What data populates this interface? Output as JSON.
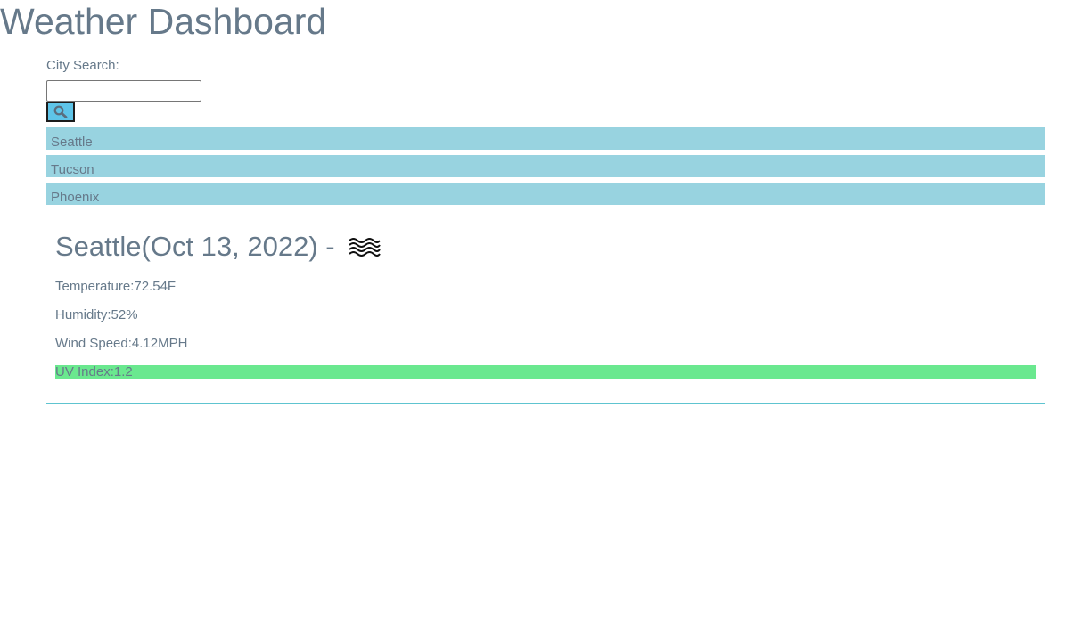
{
  "page": {
    "title": "Weather Dashboard"
  },
  "search": {
    "label": "City Search:",
    "value": "",
    "placeholder": "",
    "button_icon": "search-icon"
  },
  "history": [
    {
      "label": "Seattle"
    },
    {
      "label": "Tucson"
    },
    {
      "label": "Phoenix"
    }
  ],
  "current": {
    "heading": "Seattle(Oct 13, 2022) -",
    "icon": "mist-icon",
    "temperature": "Temperature:72.54F",
    "humidity": "Humidity:52%",
    "wind": "Wind Speed:4.12MPH",
    "uv": "UV Index:1.2"
  },
  "colors": {
    "text": "#66798a",
    "history_bg": "#98d3e0",
    "button_bg": "#5ec4e8",
    "uv_low": "#6ae88f"
  }
}
